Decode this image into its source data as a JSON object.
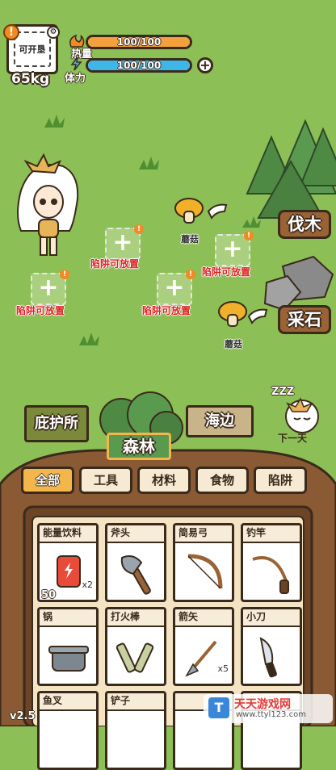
{
  "hud": {
    "portrait_label": "可开垦",
    "alert_mark": "!",
    "weight": "65kg",
    "heat_label": "热量",
    "heat_value": "100/100",
    "heat_fraction": 1.0,
    "stamina_label": "体力",
    "stamina_value": "100/100",
    "stamina_fraction": 1.0,
    "add_label": "+"
  },
  "map": {
    "trap_label": "陷阱可放置",
    "trap_plus": "+",
    "mushroom_label": "蘑菇",
    "chop_label": "伐木",
    "mine_label": "采石"
  },
  "locations": {
    "shelter": "庇护所",
    "forest": "森林",
    "seaside": "海边",
    "next_day": "下一天",
    "zzz": "ZZZ"
  },
  "tabs": [
    "全部",
    "工具",
    "材料",
    "食物",
    "陷阱"
  ],
  "items": [
    {
      "name": "能量饮料",
      "qty": "x2",
      "count": "50"
    },
    {
      "name": "斧头",
      "qty": "",
      "count": ""
    },
    {
      "name": "简易弓",
      "qty": "",
      "count": ""
    },
    {
      "name": "钓竿",
      "qty": "",
      "count": ""
    },
    {
      "name": "锅",
      "qty": "",
      "count": ""
    },
    {
      "name": "打火棒",
      "qty": "",
      "count": ""
    },
    {
      "name": "箭矢",
      "qty": "x5",
      "count": ""
    },
    {
      "name": "小刀",
      "qty": "",
      "count": ""
    },
    {
      "name": "鱼叉",
      "qty": "",
      "count": ""
    },
    {
      "name": "铲子",
      "qty": "",
      "count": ""
    },
    {
      "name": "",
      "qty": "",
      "count": ""
    },
    {
      "name": "",
      "qty": "",
      "count": ""
    }
  ],
  "footer": {
    "version": "v2.5",
    "watermark_cn": "天天游戏网",
    "watermark_url": "www.ttyl123.com"
  },
  "colors": {
    "grass": "#8cbf55",
    "heat_bar": "#f2a13c",
    "stamina_bar": "#3fb6e8",
    "wood": "#8a5a34",
    "outline": "#3a2a1c"
  }
}
